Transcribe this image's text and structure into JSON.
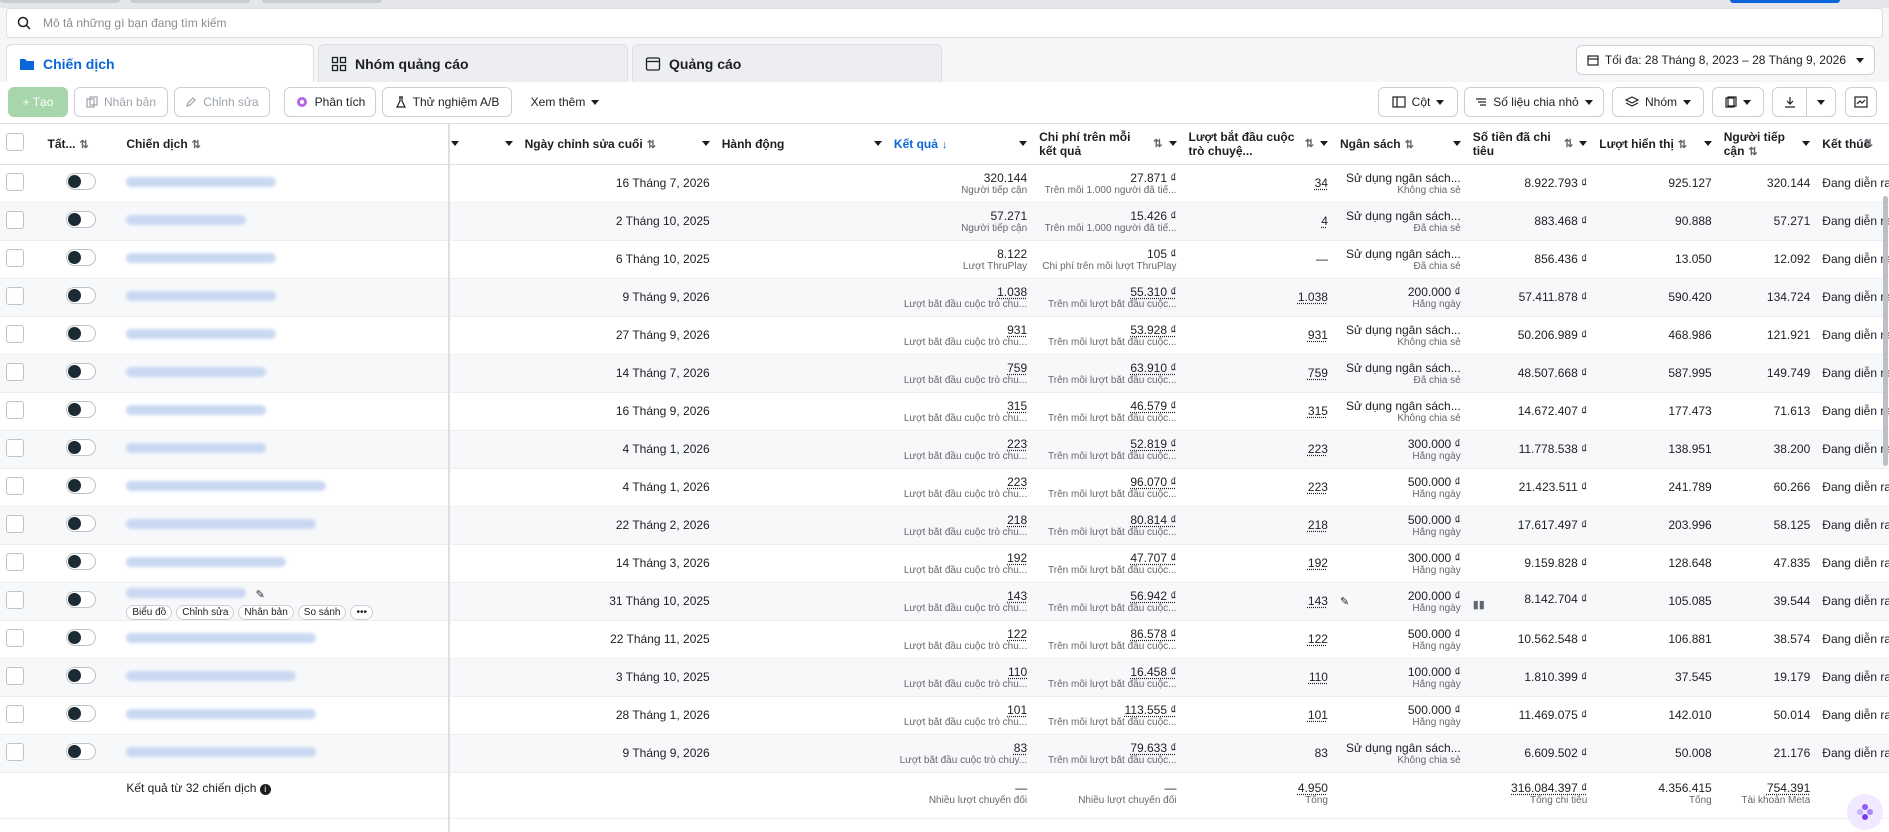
{
  "search": {
    "placeholder": "Mô tả những gì bạn đang tìm kiếm"
  },
  "tabs": [
    {
      "label": "Chiến dịch",
      "icon": "folder-icon",
      "active": true
    },
    {
      "label": "Nhóm quảng cáo",
      "icon": "grid-icon",
      "active": false
    },
    {
      "label": "Quảng cáo",
      "icon": "ad-icon",
      "active": false
    }
  ],
  "date_range": "Tối đa: 28 Tháng 8, 2023 – 28 Tháng 9, 2026",
  "toolbar": {
    "create": "+ Tạo",
    "duplicate": "Nhân bản",
    "edit": "Chỉnh sửa",
    "analyze": "Phân tích",
    "ab_test": "Thử nghiệm A/B",
    "more": "Xem thêm",
    "columns": "Cột",
    "breakdown": "Số liệu chia nhỏ",
    "group": "Nhóm"
  },
  "headers": {
    "all": "Tất...",
    "campaign": "Chiến dịch",
    "modified": "Ngày chỉnh sửa cuối",
    "action": "Hành động",
    "results": "Kết quả",
    "cost_per_result": "Chi phí trên mỗi kết quả",
    "conv_started": "Lượt bắt đầu cuộc trò chuyệ...",
    "budget": "Ngân sách",
    "spent": "Số tiền đã chi tiêu",
    "impressions": "Lượt hiển thị",
    "reach": "Người tiếp cận",
    "end": "Kết thúc"
  },
  "hover_actions": [
    "Biểu đồ",
    "Chỉnh sửa",
    "Nhân bản",
    "So sánh"
  ],
  "rows": [
    {
      "modified": "16 Tháng 7, 2026",
      "result": "320.144",
      "result_sub": "Người tiếp cận",
      "cpr": "27.871 ₫",
      "cpr_sub": "Trên mỗi 1.000 người đã tiế...",
      "conv": "34",
      "budget": "Sử dụng ngân sách...",
      "budget_sub": "Không chia sẻ",
      "spent": "8.922.793 ₫",
      "impr": "925.127",
      "reach": "320.144",
      "end": "Đang diễn ra"
    },
    {
      "modified": "2 Tháng 10, 2025",
      "result": "57.271",
      "result_sub": "Người tiếp cận",
      "cpr": "15.426 ₫",
      "cpr_sub": "Trên mỗi 1.000 người đã tiế...",
      "conv": "4",
      "budget": "Sử dụng ngân sách...",
      "budget_sub": "Đã chia sẻ",
      "spent": "883.468 ₫",
      "impr": "90.888",
      "reach": "57.271",
      "end": "Đang diễn ra"
    },
    {
      "modified": "6 Tháng 10, 2025",
      "result": "8.122",
      "result_sub": "Lượt ThruPlay",
      "cpr": "105 ₫",
      "cpr_sub": "Chi phí trên mỗi lượt ThruPlay",
      "conv": "—",
      "budget": "Sử dụng ngân sách...",
      "budget_sub": "Đã chia sẻ",
      "spent": "856.436 ₫",
      "impr": "13.050",
      "reach": "12.092",
      "end": "Đang diễn ra"
    },
    {
      "modified": "9 Tháng 9, 2026",
      "result": "1.038",
      "result_sub": "Lượt bắt đầu cuộc trò chu...",
      "cpr": "55.310 ₫",
      "cpr_sub": "Trên mỗi lượt bắt đầu cuộc...",
      "conv": "1.038",
      "budget": "200.000 ₫",
      "budget_sub": "Hằng ngày",
      "spent": "57.411.878 ₫",
      "impr": "590.420",
      "reach": "134.724",
      "end": "Đang diễn ra"
    },
    {
      "modified": "27 Tháng 9, 2026",
      "result": "931",
      "result_sub": "Lượt bắt đầu cuộc trò chu...",
      "cpr": "53.928 ₫",
      "cpr_sub": "Trên mỗi lượt bắt đầu cuộc...",
      "conv": "931",
      "budget": "Sử dụng ngân sách...",
      "budget_sub": "Không chia sẻ",
      "spent": "50.206.989 ₫",
      "impr": "468.986",
      "reach": "121.921",
      "end": "Đang diễn ra"
    },
    {
      "modified": "14 Tháng 7, 2026",
      "result": "759",
      "result_sub": "Lượt bắt đầu cuộc trò chu...",
      "cpr": "63.910 ₫",
      "cpr_sub": "Trên mỗi lượt bắt đầu cuộc...",
      "conv": "759",
      "budget": "Sử dụng ngân sách...",
      "budget_sub": "Đã chia sẻ",
      "spent": "48.507.668 ₫",
      "impr": "587.995",
      "reach": "149.749",
      "end": "Đang diễn ra"
    },
    {
      "modified": "16 Tháng 9, 2026",
      "result": "315",
      "result_sub": "Lượt bắt đầu cuộc trò chu...",
      "cpr": "46.579 ₫",
      "cpr_sub": "Trên mỗi lượt bắt đầu cuộc...",
      "conv": "315",
      "budget": "Sử dụng ngân sách...",
      "budget_sub": "Không chia sẻ",
      "spent": "14.672.407 ₫",
      "impr": "177.473",
      "reach": "71.613",
      "end": "Đang diễn ra"
    },
    {
      "modified": "4 Tháng 1, 2026",
      "result": "223",
      "result_sub": "Lượt bắt đầu cuộc trò chu...",
      "cpr": "52.819 ₫",
      "cpr_sub": "Trên mỗi lượt bắt đầu cuộc...",
      "conv": "223",
      "budget": "300.000 ₫",
      "budget_sub": "Hằng ngày",
      "spent": "11.778.538 ₫",
      "impr": "138.951",
      "reach": "38.200",
      "end": "Đang diễn ra"
    },
    {
      "modified": "4 Tháng 1, 2026",
      "result": "223",
      "result_sub": "Lượt bắt đầu cuộc trò chu...",
      "cpr": "96.070 ₫",
      "cpr_sub": "Trên mỗi lượt bắt đầu cuộc...",
      "conv": "223",
      "budget": "500.000 ₫",
      "budget_sub": "Hằng ngày",
      "spent": "21.423.511 ₫",
      "impr": "241.789",
      "reach": "60.266",
      "end": "Đang diễn ra"
    },
    {
      "modified": "22 Tháng 2, 2026",
      "result": "218",
      "result_sub": "Lượt bắt đầu cuộc trò chu...",
      "cpr": "80.814 ₫",
      "cpr_sub": "Trên mỗi lượt bắt đầu cuộc...",
      "conv": "218",
      "budget": "500.000 ₫",
      "budget_sub": "Hằng ngày",
      "spent": "17.617.497 ₫",
      "impr": "203.996",
      "reach": "58.125",
      "end": "Đang diễn ra"
    },
    {
      "modified": "14 Tháng 3, 2026",
      "result": "192",
      "result_sub": "Lượt bắt đầu cuộc trò chu...",
      "cpr": "47.707 ₫",
      "cpr_sub": "Trên mỗi lượt bắt đầu cuộc...",
      "conv": "192",
      "budget": "300.000 ₫",
      "budget_sub": "Hằng ngày",
      "spent": "9.159.828 ₫",
      "impr": "128.648",
      "reach": "47.835",
      "end": "Đang diễn ra"
    },
    {
      "modified": "31 Tháng 10, 2025",
      "result": "143",
      "result_sub": "Lượt bắt đầu cuộc trò chu...",
      "cpr": "56.942 ₫",
      "cpr_sub": "Trên mỗi lượt bắt đầu cuộc...",
      "conv": "143",
      "budget": "200.000 ₫",
      "budget_sub": "Hằng ngày",
      "spent": "8.142.704 ₫",
      "impr": "105.085",
      "reach": "39.544",
      "end": "Đang diễn ra",
      "hover": true
    },
    {
      "modified": "22 Tháng 11, 2025",
      "result": "122",
      "result_sub": "Lượt bắt đầu cuộc trò chu...",
      "cpr": "86.578 ₫",
      "cpr_sub": "Trên mỗi lượt bắt đầu cuộc...",
      "conv": "122",
      "budget": "500.000 ₫",
      "budget_sub": "Hằng ngày",
      "spent": "10.562.548 ₫",
      "impr": "106.881",
      "reach": "38.574",
      "end": "Đang diễn ra"
    },
    {
      "modified": "3 Tháng 10, 2025",
      "result": "110",
      "result_sub": "Lượt bắt đầu cuộc trò chu...",
      "cpr": "16.458 ₫",
      "cpr_sub": "Trên mỗi lượt bắt đầu cuộc...",
      "conv": "110",
      "budget": "100.000 ₫",
      "budget_sub": "Hằng ngày",
      "spent": "1.810.399 ₫",
      "impr": "37.545",
      "reach": "19.179",
      "end": "Đang diễn ra"
    },
    {
      "modified": "28 Tháng 1, 2026",
      "result": "101",
      "result_sub": "Lượt bắt đầu cuộc trò chu...",
      "cpr": "113.555 ₫",
      "cpr_sub": "Trên mỗi lượt bắt đầu cuộc...",
      "conv": "101",
      "budget": "500.000 ₫",
      "budget_sub": "Hằng ngày",
      "spent": "11.469.075 ₫",
      "impr": "142.010",
      "reach": "50.014",
      "end": "Đang diễn ra"
    },
    {
      "modified": "9 Tháng 9, 2026",
      "result": "83",
      "result_sub": "Lượt bắt đầu cuộc trò chuy...",
      "cpr": "79.633 ₫",
      "cpr_sub": "Trên mỗi lượt bắt đầu cuộc...",
      "conv": "83",
      "budget": "Sử dụng ngân sách...",
      "budget_sub": "Không chia sẻ",
      "spent": "6.609.502 ₫",
      "impr": "50.008",
      "reach": "21.176",
      "end": "Đang diễn ra"
    }
  ],
  "footer": {
    "label": "Kết quả từ 32 chiến dịch",
    "result": "—",
    "result_sub": "Nhiều lượt chuyển đổi",
    "cpr": "—",
    "cpr_sub": "Nhiều lượt chuyển đổi",
    "conv": "4.950",
    "conv_sub": "Tổng",
    "spent": "316.084.397 ₫",
    "spent_sub": "Tổng chi tiêu",
    "impr": "4.356.415",
    "impr_sub": "Tổng",
    "reach": "754.391",
    "reach_sub": "Tài khoản Meta"
  }
}
